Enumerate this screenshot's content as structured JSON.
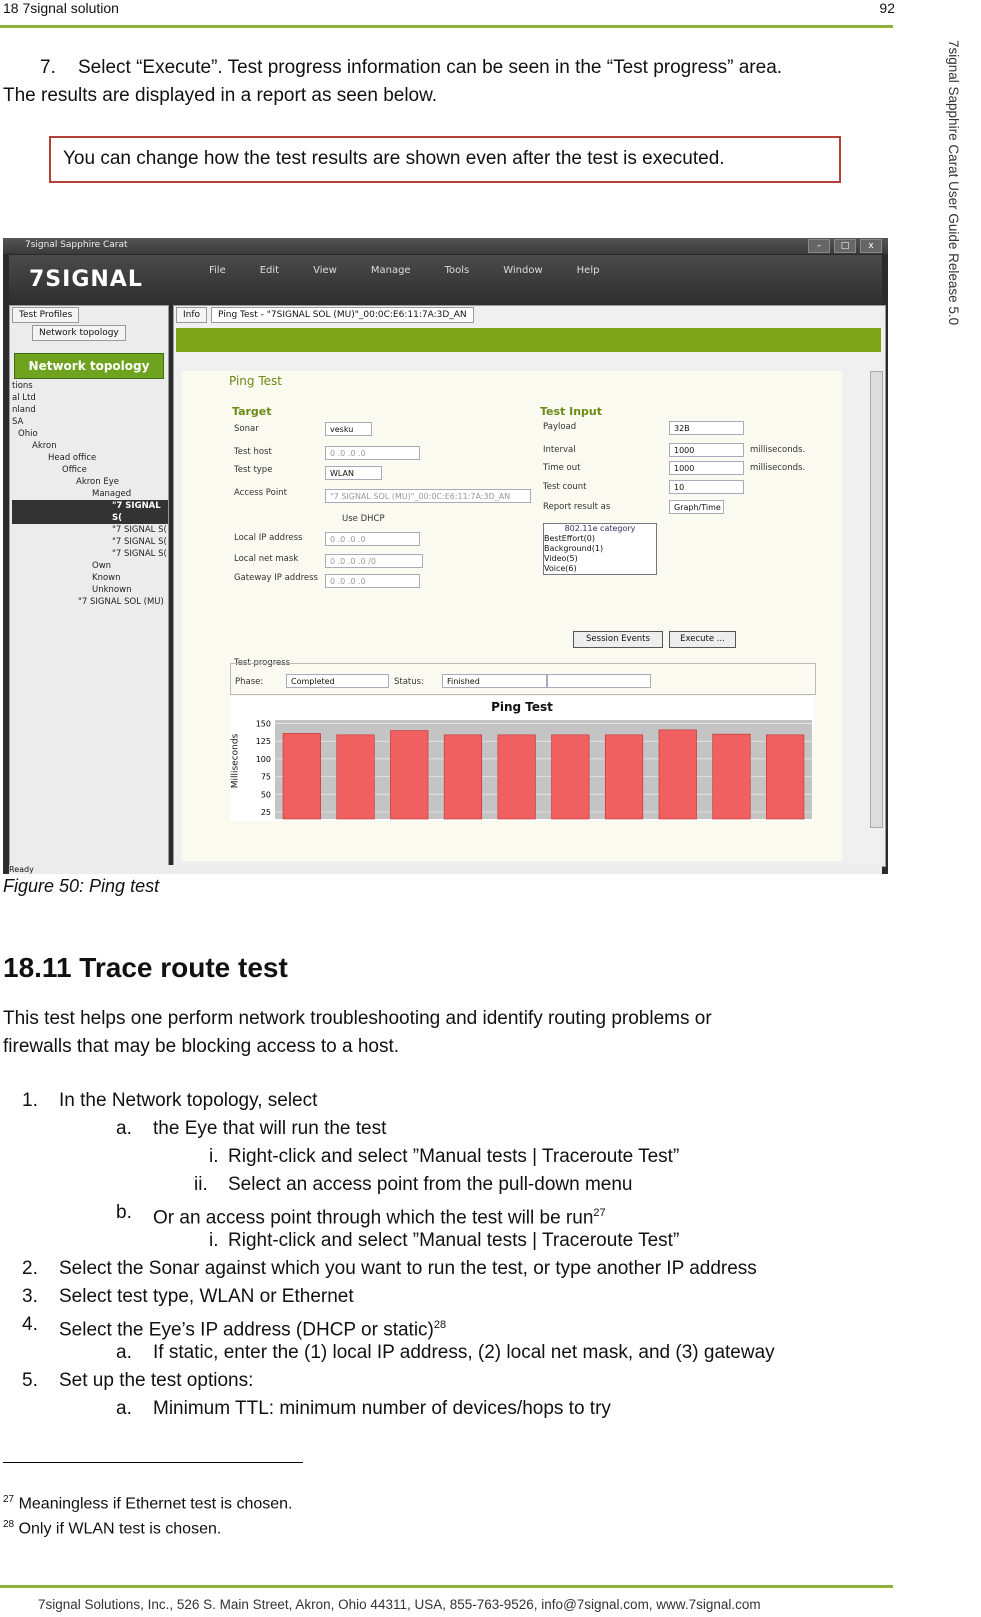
{
  "header": {
    "left": "18 7signal solution",
    "right": "92"
  },
  "side_text": "7signal Sapphire Carat User Guide Release 5.0",
  "step7": {
    "num": "7.",
    "line1": "Select “Execute”. Test progress information can be seen in the “Test progress” area.",
    "line2": "The results are displayed in a report as seen below."
  },
  "note": "You can change how the test results are shown even after the test is executed.",
  "screenshot": {
    "window_title": "7signal Sapphire Carat",
    "logo": "7SIGNAL",
    "menu": [
      "File",
      "Edit",
      "View",
      "Manage",
      "Tools",
      "Window",
      "Help"
    ],
    "left_tabs": [
      "Test Profiles",
      "Network topology"
    ],
    "network_topology_button": "Network topology",
    "tree": [
      "tions",
      "al Ltd",
      "nland",
      "SA",
      "Ohio",
      "Akron",
      "Head office",
      "Office",
      "Akron Eye",
      "Managed",
      "\"7 SIGNAL S(",
      "\"7 SIGNAL S(",
      "\"7 SIGNAL S(",
      "\"7 SIGNAL S(",
      "Own",
      "Known",
      "Unknown",
      "\"7 SIGNAL SOL (MU)"
    ],
    "main_tabs": [
      "Info",
      "Ping Test - \"7SIGNAL SOL (MU)\"_00:0C:E6:11:7A:3D_AN"
    ],
    "form_title": "Ping Test",
    "target": {
      "title": "Target",
      "sonar_label": "Sonar",
      "sonar_value": "vesku",
      "test_host_label": "Test host",
      "test_host_value": "0  .0  .0  .0",
      "test_type_label": "Test type",
      "test_type_value": "WLAN",
      "access_point_label": "Access Point",
      "access_point_value": "\"7 SIGNAL SOL (MU)\"_00:0C:E6:11:7A:3D_AN",
      "use_dhcp": "Use DHCP",
      "local_ip_label": "Local IP address",
      "local_ip_value": "0  .0  .0  .0",
      "local_mask_label": "Local net mask",
      "local_mask_value": "0  .0  .0  .0  /0",
      "gateway_label": "Gateway IP address",
      "gateway_value": "0  .0  .0  .0"
    },
    "input": {
      "title": "Test Input",
      "payload_label": "Payload",
      "payload_value": "32B",
      "interval_label": "Interval",
      "interval_value": "1000",
      "interval_unit": "milliseconds.",
      "timeout_label": "Time out",
      "timeout_value": "1000",
      "timeout_unit": "milliseconds.",
      "count_label": "Test count",
      "count_value": "10",
      "report_label": "Report result as",
      "report_value": "Graph/Time",
      "category_title": "802.11e category",
      "categories": [
        "BestEffort(0)",
        "Background(1)",
        "Video(5)",
        "Voice(6)"
      ]
    },
    "buttons": {
      "session": "Session Events",
      "execute": "Execute ..."
    },
    "progress": {
      "title": "Test progress",
      "phase_label": "Phase:",
      "phase_value": "Completed",
      "status_label": "Status:",
      "status_value": "Finished"
    },
    "status_bar": "Ready"
  },
  "chart_data": {
    "type": "bar",
    "title": "Ping Test",
    "ylabel": "Milliseconds",
    "yticks": [
      150,
      125,
      100,
      75,
      50,
      25
    ],
    "ylim": [
      15,
      155
    ],
    "values": [
      136,
      134,
      140,
      134,
      134,
      134,
      134,
      141,
      135,
      134
    ],
    "color": "#f06060"
  },
  "caption": "Figure 50: Ping test",
  "section_title": "18.11 Trace route test",
  "intro": {
    "line1": "This test helps one perform network troubleshooting and identify routing problems or",
    "line2": "firewalls that may be blocking access to a host."
  },
  "list": {
    "s1": "In the Network topology, select",
    "s1a": "the Eye that will run the test",
    "s1a_i": "Right-click and select ”Manual tests | Traceroute Test”",
    "s1a_ii": "Select an access point from the pull-down menu",
    "s1b": "Or an access point through which the test will be run",
    "s1b_sup": "27",
    "s1b_i": "Right-click and select ”Manual tests | Traceroute Test”",
    "s2": "Select the Sonar against which you want to run the test, or type another IP address",
    "s3": "Select test type, WLAN or Ethernet",
    "s4": "Select the Eye’s IP address (DHCP or static)",
    "s4_sup": "28",
    "s4a": "If static, enter the (1) local IP address, (2) local net mask, and (3) gateway",
    "s5": "Set up the test options:",
    "s5a": "Minimum TTL: minimum number of devices/hops to try"
  },
  "footnotes": [
    {
      "num": "27",
      "text": "Meaningless if Ethernet test is chosen."
    },
    {
      "num": "28",
      "text": "Only if WLAN test is chosen."
    }
  ],
  "footer": "7signal Solutions, Inc., 526 S. Main Street, Akron, Ohio 44311, USA, 855-763-9526, info@7signal.com, www.7signal.com"
}
